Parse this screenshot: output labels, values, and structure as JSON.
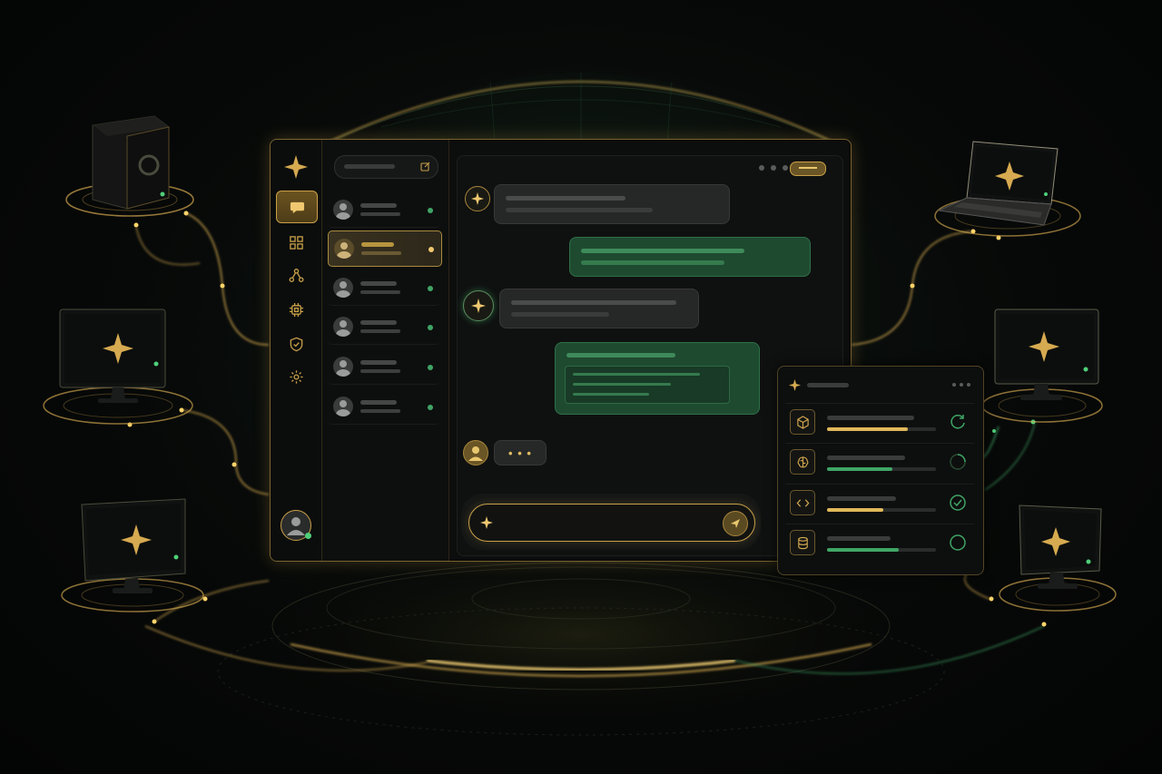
{
  "colors": {
    "gold": "#d6aa50",
    "green": "#3fa566",
    "background": "#070908"
  },
  "nav_rail": {
    "items": [
      {
        "icon": "chat-bubble-icon",
        "active": true
      },
      {
        "icon": "grid-icon",
        "active": false
      },
      {
        "icon": "network-icon",
        "active": false
      },
      {
        "icon": "chip-icon",
        "active": false
      },
      {
        "icon": "shield-icon",
        "active": false
      },
      {
        "icon": "gear-icon",
        "active": false
      }
    ],
    "user": {
      "icon": "user-avatar-icon",
      "online": true
    }
  },
  "conversation_list": {
    "search_icon": "new-chat-icon",
    "items": [
      {
        "active": false,
        "status": "online"
      },
      {
        "active": true,
        "status": "active"
      },
      {
        "active": false,
        "status": "online"
      },
      {
        "active": false,
        "status": "online"
      },
      {
        "active": false,
        "status": "online"
      },
      {
        "active": false,
        "status": "online"
      }
    ]
  },
  "chat": {
    "header_icons": [
      "more-dots-icon",
      "toggle-pill-icon"
    ],
    "messages": [
      {
        "from": "assistant",
        "kind": "text"
      },
      {
        "from": "user",
        "kind": "text"
      },
      {
        "from": "assistant",
        "kind": "text"
      },
      {
        "from": "user",
        "kind": "code"
      },
      {
        "from": "user-typing",
        "kind": "typing",
        "text": "• • •"
      }
    ],
    "composer": {
      "leading_icon": "sparkle-icon",
      "send_icon": "send-icon"
    }
  },
  "task_panel": {
    "header_icon": "sparkle-icon",
    "tasks": [
      {
        "icon": "cube-icon",
        "progress": 0.74,
        "bar_color": "gold",
        "status": "syncing"
      },
      {
        "icon": "brain-icon",
        "progress": 0.6,
        "bar_color": "green",
        "status": "running"
      },
      {
        "icon": "code-icon",
        "progress": 0.52,
        "bar_color": "gold",
        "status": "done"
      },
      {
        "icon": "database-icon",
        "progress": 0.66,
        "bar_color": "green",
        "status": "pending"
      }
    ]
  },
  "devices": [
    {
      "icon": "server-icon",
      "position": "top-left"
    },
    {
      "icon": "monitor-icon",
      "position": "middle-left"
    },
    {
      "icon": "monitor-icon",
      "position": "bottom-left"
    },
    {
      "icon": "laptop-icon",
      "position": "top-right"
    },
    {
      "icon": "monitor-icon",
      "position": "middle-right"
    },
    {
      "icon": "monitor-icon",
      "position": "bottom-right"
    }
  ]
}
